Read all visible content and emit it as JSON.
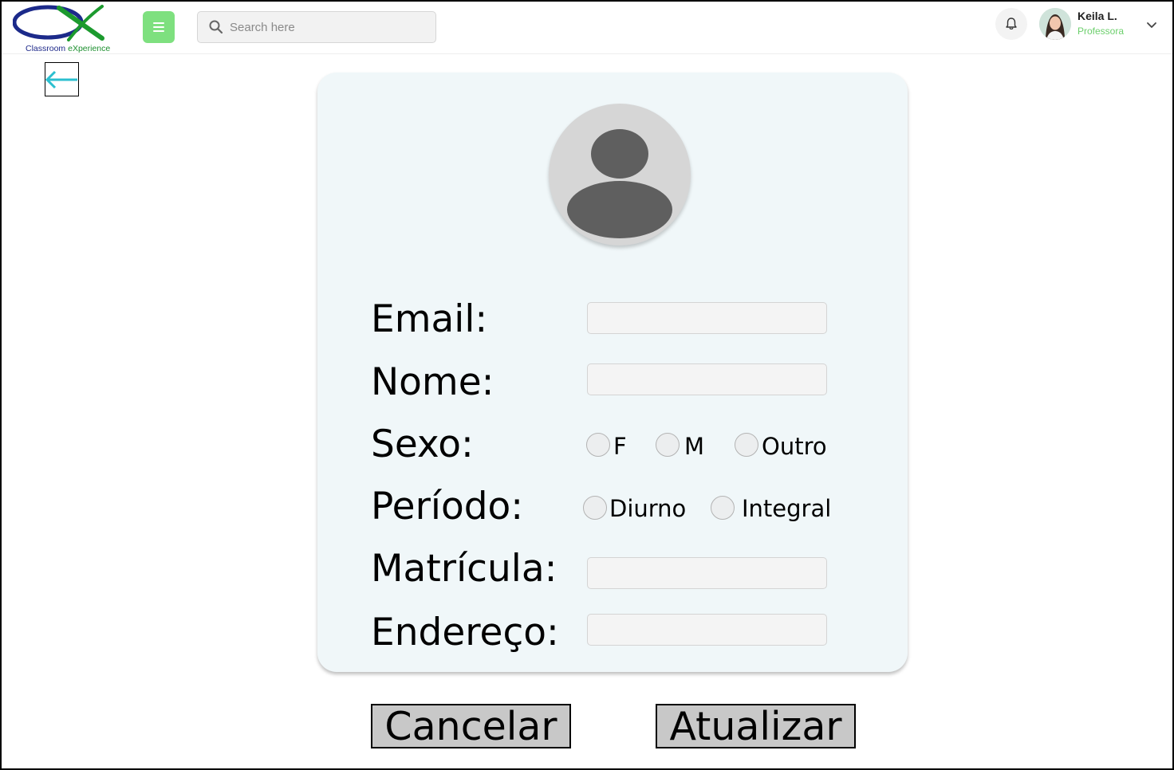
{
  "header": {
    "logo": {
      "text_part1": "Classroom ",
      "text_part2": "eXperience"
    },
    "search": {
      "placeholder": "Search here"
    },
    "user": {
      "name": "Keila L.",
      "role": "Professora"
    },
    "icons": [
      "menu-icon",
      "search-icon",
      "bell-icon",
      "chevron-down-icon"
    ]
  },
  "form": {
    "labels": {
      "email": "Email:",
      "nome": "Nome:",
      "sexo": "Sexo:",
      "periodo": "Período:",
      "matricula": "Matrícula:",
      "endereco": "Endereço:"
    },
    "fields": {
      "email": "",
      "nome": "",
      "matricula": "",
      "endereco": ""
    },
    "sexo_options": [
      "F",
      "M",
      "Outro"
    ],
    "periodo_options": [
      "Diurno",
      "Integral"
    ]
  },
  "actions": {
    "cancel": "Cancelar",
    "update": "Atualizar"
  },
  "colors": {
    "menu_button": "#7ee07f",
    "card_background": "#f0f7f9",
    "back_arrow": "#2bbfcf",
    "role_text": "#6ccf6c"
  }
}
